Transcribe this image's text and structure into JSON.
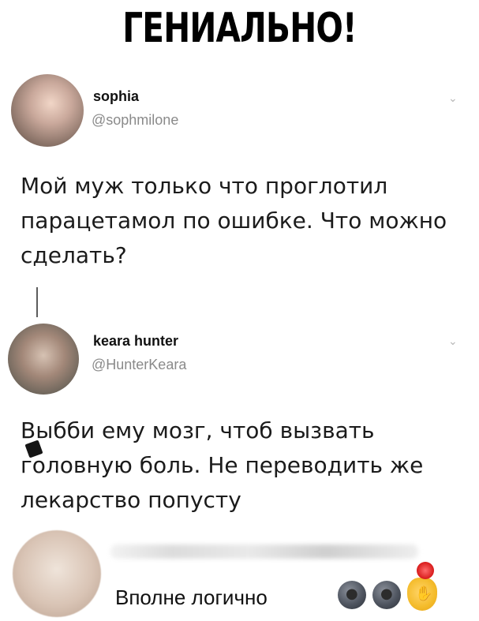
{
  "headline": "ГЕНИАЛЬНО!",
  "tweet1": {
    "name": "sophia",
    "handle": "@sophmilone",
    "text": "Мой муж только что проглотил парацетамол по ошибке. Что можно сделать?"
  },
  "tweet2": {
    "name": "keara hunter",
    "handle": "@HunterKeara",
    "text": "Выбби ему мозг, чтоб вызвать головную боль. Не переводить же лекарство попусту"
  },
  "comment": {
    "text": "Вполне логично"
  },
  "icons": {
    "chevron": "chevron-down-icon",
    "moon": "moon-face-icon",
    "ok": "ok-hand-icon",
    "badge": "red-badge-icon",
    "sticker": "censored-sticker-icon"
  },
  "colors": {
    "text": "#111111",
    "handle": "#8a8a8a",
    "chevron": "#b7b7b7"
  }
}
